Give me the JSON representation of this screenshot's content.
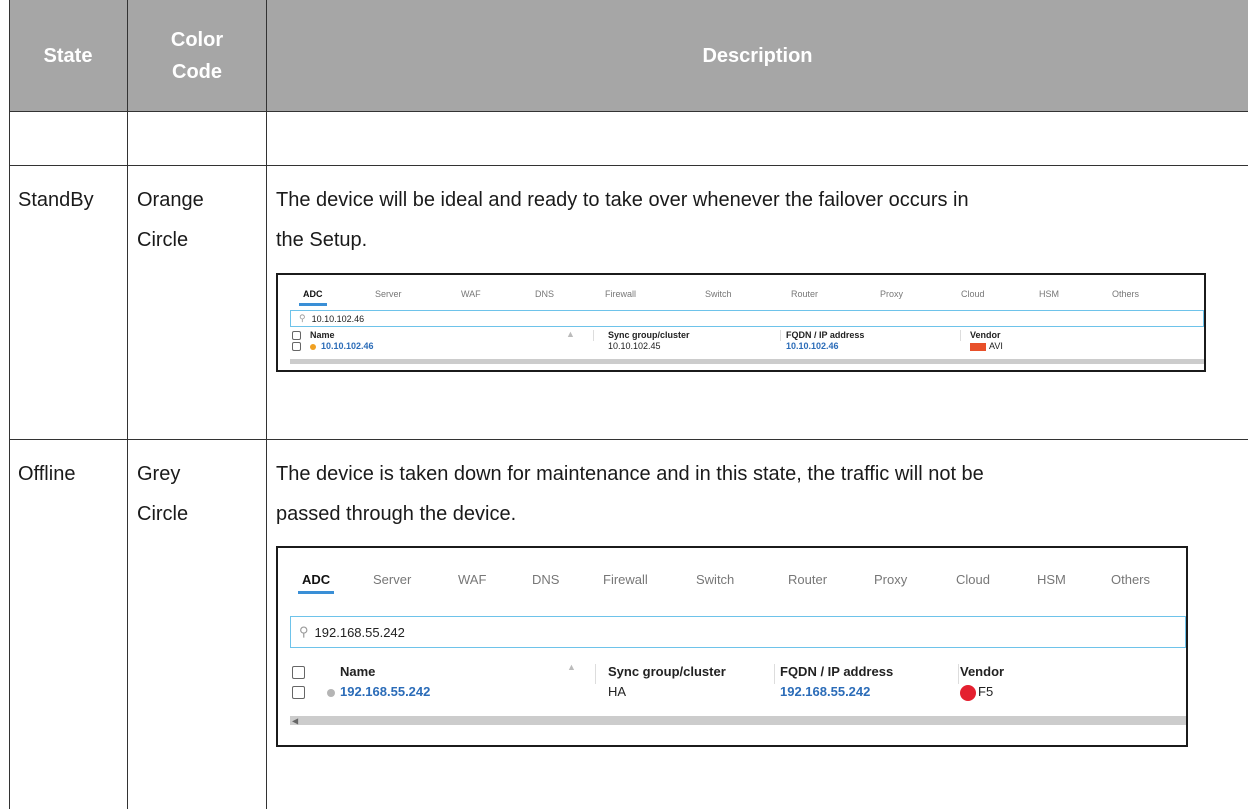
{
  "header": {
    "state": "State",
    "color_line1": "Color",
    "color_line2": "Code",
    "description": "Description"
  },
  "rows": [
    {
      "state": "StandBy",
      "color_line1": "Orange",
      "color_line2": "Circle",
      "desc_line1": "The device will be ideal and ready to take over whenever the failover occurs in",
      "desc_line2": "the Setup.",
      "dot_color": "#f0a020"
    },
    {
      "state": "Offline",
      "color_line1": "Grey",
      "color_line2": "Circle",
      "desc_line1": "The device is taken down for maintenance and in this state, the traffic will not be",
      "desc_line2": "passed through the device.",
      "dot_color": "#b5b5b5"
    }
  ],
  "shot1": {
    "tabs": [
      "ADC",
      "Server",
      "WAF",
      "DNS",
      "Firewall",
      "Switch",
      "Router",
      "Proxy",
      "Cloud",
      "HSM",
      "Others"
    ],
    "search_value": "10.10.102.46",
    "columns": [
      "Name",
      "Sync group/cluster",
      "FQDN / IP address",
      "Vendor"
    ],
    "row": {
      "name": "10.10.102.46",
      "sync": "10.10.102.45",
      "fqdn": "10.10.102.46",
      "vendor": "AVI"
    },
    "vendor_badge_color": "#e8502a"
  },
  "shot2": {
    "tabs": [
      "ADC",
      "Server",
      "WAF",
      "DNS",
      "Firewall",
      "Switch",
      "Router",
      "Proxy",
      "Cloud",
      "HSM",
      "Others"
    ],
    "search_value": "192.168.55.242",
    "columns": [
      "Name",
      "Sync group/cluster",
      "FQDN / IP address",
      "Vendor"
    ],
    "row": {
      "name": "192.168.55.242",
      "sync": "HA",
      "fqdn": "192.168.55.242",
      "vendor": "F5"
    },
    "vendor_badge_color": "#e4202f"
  },
  "icons": {
    "search": "magnifier-icon",
    "sort": "sort-arrows-icon",
    "scroll_left": "arrow-left-icon"
  }
}
